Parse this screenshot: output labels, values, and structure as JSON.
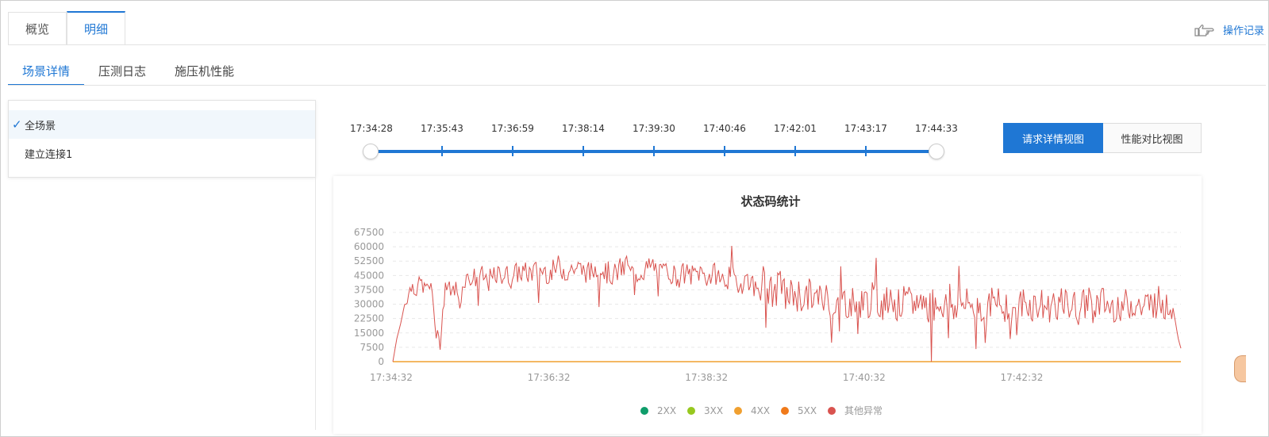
{
  "tabs": {
    "top": [
      {
        "label": "概览",
        "active": false
      },
      {
        "label": "明细",
        "active": true
      }
    ]
  },
  "operation_log": {
    "label": "操作记录",
    "icon": "pointing-hand-icon"
  },
  "sub_tabs": [
    {
      "label": "场景详情",
      "active": true
    },
    {
      "label": "压测日志",
      "active": false
    },
    {
      "label": "施压机性能",
      "active": false
    }
  ],
  "scenes": [
    {
      "label": "全场景",
      "selected": true
    },
    {
      "label": "建立连接1",
      "selected": false
    }
  ],
  "timeline": {
    "labels": [
      "17:34:28",
      "17:35:43",
      "17:36:59",
      "17:38:14",
      "17:39:30",
      "17:40:46",
      "17:42:01",
      "17:43:17",
      "17:44:33"
    ]
  },
  "view_buttons": {
    "detail": "请求详情视图",
    "compare": "性能对比视图"
  },
  "chart_data": {
    "type": "line",
    "title": "状态码统计",
    "y_ticks": [
      0,
      7500,
      15000,
      22500,
      30000,
      37500,
      45000,
      52500,
      60000,
      67500
    ],
    "ylim": [
      0,
      67500
    ],
    "x_tick_labels": [
      "17:34:32",
      "17:36:32",
      "17:38:32",
      "17:40:32",
      "17:42:32"
    ],
    "x_range_seconds": [
      0,
      600
    ],
    "legend": [
      {
        "name": "2XX",
        "color": "#0f9d6b"
      },
      {
        "name": "3XX",
        "color": "#97c81f"
      },
      {
        "name": "4XX",
        "color": "#f0a030"
      },
      {
        "name": "5XX",
        "color": "#f07a1a"
      },
      {
        "name": "其他异常",
        "color": "#d9534f"
      }
    ],
    "series": [
      {
        "name": "4XX",
        "values_note": "flat",
        "values": [
          0,
          0
        ]
      },
      {
        "name": "其他异常",
        "approx_points": [
          [
            0,
            0
          ],
          [
            3,
            12000
          ],
          [
            6,
            20000
          ],
          [
            9,
            30000
          ],
          [
            12,
            36000
          ],
          [
            15,
            40000
          ],
          [
            18,
            37000
          ],
          [
            21,
            42000
          ],
          [
            24,
            38000
          ],
          [
            27,
            40000
          ],
          [
            30,
            36000
          ],
          [
            33,
            14000
          ],
          [
            36,
            10000
          ],
          [
            39,
            33000
          ],
          [
            42,
            40000
          ],
          [
            45,
            36000
          ],
          [
            48,
            39000
          ],
          [
            51,
            30000
          ],
          [
            54,
            42000
          ],
          [
            57,
            44000
          ],
          [
            60,
            43000
          ],
          [
            66,
            45000
          ],
          [
            72,
            42000
          ],
          [
            78,
            44000
          ],
          [
            84,
            46000
          ],
          [
            90,
            44000
          ],
          [
            96,
            47000
          ],
          [
            102,
            46000
          ],
          [
            108,
            47000
          ],
          [
            114,
            48000
          ],
          [
            120,
            46000
          ],
          [
            126,
            50000
          ],
          [
            132,
            47000
          ],
          [
            138,
            49000
          ],
          [
            144,
            48000
          ],
          [
            150,
            46000
          ],
          [
            156,
            50000
          ],
          [
            162,
            47000
          ],
          [
            168,
            45000
          ],
          [
            174,
            49000
          ],
          [
            180,
            47000
          ],
          [
            186,
            46000
          ],
          [
            192,
            48000
          ],
          [
            198,
            50000
          ],
          [
            204,
            45000
          ],
          [
            210,
            48000
          ],
          [
            216,
            44000
          ],
          [
            222,
            46000
          ],
          [
            228,
            45000
          ],
          [
            234,
            47000
          ],
          [
            240,
            44000
          ],
          [
            246,
            46000
          ],
          [
            252,
            42000
          ],
          [
            258,
            45000
          ],
          [
            264,
            40000
          ],
          [
            270,
            44000
          ],
          [
            276,
            38000
          ],
          [
            282,
            42000
          ],
          [
            288,
            36000
          ],
          [
            294,
            38000
          ],
          [
            300,
            34000
          ],
          [
            306,
            36000
          ],
          [
            312,
            33000
          ],
          [
            318,
            35000
          ],
          [
            324,
            32000
          ],
          [
            330,
            34000
          ],
          [
            336,
            31000
          ],
          [
            342,
            33000
          ],
          [
            348,
            30000
          ],
          [
            354,
            32000
          ],
          [
            360,
            31000
          ],
          [
            366,
            33000
          ],
          [
            372,
            30000
          ],
          [
            378,
            32000
          ],
          [
            384,
            29000
          ],
          [
            390,
            31000
          ],
          [
            396,
            30000
          ],
          [
            402,
            32000
          ],
          [
            408,
            29000
          ],
          [
            414,
            31000
          ],
          [
            420,
            30000
          ],
          [
            426,
            28000
          ],
          [
            432,
            31000
          ],
          [
            438,
            29000
          ],
          [
            444,
            30000
          ],
          [
            450,
            28000
          ],
          [
            456,
            31000
          ],
          [
            462,
            29000
          ],
          [
            468,
            30000
          ],
          [
            474,
            28000
          ],
          [
            480,
            31000
          ],
          [
            486,
            29000
          ],
          [
            492,
            30000
          ],
          [
            498,
            28000
          ],
          [
            504,
            31000
          ],
          [
            510,
            29000
          ],
          [
            516,
            30000
          ],
          [
            522,
            27000
          ],
          [
            528,
            30000
          ],
          [
            534,
            29000
          ],
          [
            540,
            31000
          ],
          [
            546,
            28000
          ],
          [
            552,
            30000
          ],
          [
            558,
            29000
          ],
          [
            564,
            31000
          ],
          [
            570,
            28000
          ],
          [
            576,
            30000
          ],
          [
            582,
            32000
          ],
          [
            588,
            29000
          ],
          [
            594,
            28000
          ],
          [
            598,
            12000
          ],
          [
            600,
            7000
          ]
        ]
      }
    ]
  }
}
